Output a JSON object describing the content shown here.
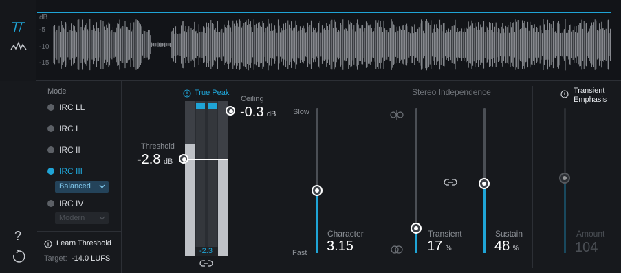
{
  "waveform": {
    "db_labels": [
      "dB",
      "-5",
      "-10",
      "-15"
    ]
  },
  "sidebar": {
    "help_glyph": "?",
    "colors": {
      "icon": "#c9ccd1",
      "accent": "#1fa4d6"
    }
  },
  "mode": {
    "title": "Mode",
    "items": [
      {
        "label": "IRC LL",
        "selected": false
      },
      {
        "label": "IRC I",
        "selected": false
      },
      {
        "label": "IRC II",
        "selected": false
      },
      {
        "label": "IRC III",
        "selected": true
      },
      {
        "label": "IRC IV",
        "selected": false
      }
    ],
    "irc3_style": "Balanced",
    "irc4_style": "Modern"
  },
  "learn": {
    "button_label": "Learn Threshold",
    "target_label": "Target:",
    "target_value": "-14.0 LUFS"
  },
  "limiter": {
    "true_peak_label": "True Peak",
    "ceiling_label": "Ceiling",
    "ceiling_value": "-0.3",
    "ceiling_unit": "dB",
    "threshold_label": "Threshold",
    "threshold_value": "-2.8",
    "threshold_unit": "dB",
    "gr_readout": "-2.3",
    "meter_levels": [
      0.72,
      0.62
    ]
  },
  "character": {
    "slow_label": "Slow",
    "fast_label": "Fast",
    "label": "Character",
    "value": "3.15",
    "position": 0.43
  },
  "stereo": {
    "title": "Stereo Independence",
    "transient_label": "Transient",
    "transient_value": "17",
    "transient_unit": "%",
    "transient_position": 0.17,
    "sustain_label": "Sustain",
    "sustain_value": "48",
    "sustain_unit": "%",
    "sustain_position": 0.48
  },
  "transient_emphasis": {
    "title_line1": "Transient",
    "title_line2": "Emphasis",
    "amount_label": "Amount",
    "amount_value": "104"
  }
}
